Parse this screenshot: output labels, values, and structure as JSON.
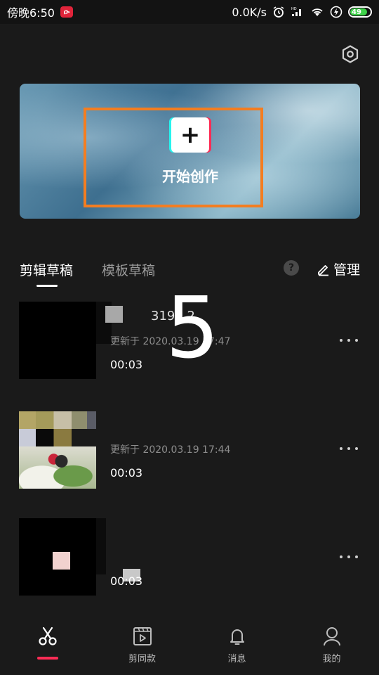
{
  "status_bar": {
    "time": "傍晚6:50",
    "speed": "0.0K/s",
    "battery": "49"
  },
  "hero": {
    "create_label": "开始创作",
    "step_number": "5"
  },
  "tabs": {
    "draft": "剪辑草稿",
    "template": "模板草稿",
    "help": "?",
    "manage": "管理"
  },
  "drafts": [
    {
      "title": "3194 2",
      "date": "更新于 2020.03.19 17:47",
      "duration": "00:03"
    },
    {
      "title": "",
      "date": "更新于 2020.03.19 17:44",
      "duration": "00:03"
    },
    {
      "title": "",
      "date": "",
      "duration": "00:03"
    }
  ],
  "bottom_nav": [
    {
      "label": "",
      "icon": "scissors-icon",
      "active": true
    },
    {
      "label": "剪同款",
      "icon": "template-play-icon",
      "active": false
    },
    {
      "label": "消息",
      "icon": "bell-icon",
      "active": false
    },
    {
      "label": "我的",
      "icon": "user-icon",
      "active": false
    }
  ],
  "colors": {
    "background": "#1a1a1a",
    "highlight_frame": "#f47d20",
    "active_indicator": "#fe2c55"
  }
}
